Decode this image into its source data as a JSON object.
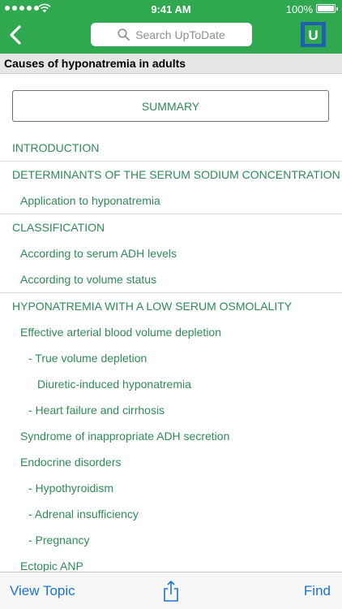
{
  "status_bar": {
    "time": "9:41 AM",
    "battery": "100%"
  },
  "nav": {
    "back_icon": "chevron-left-icon",
    "search_placeholder": "Search UpToDate",
    "logo_letter": "U"
  },
  "topic": {
    "title": "Causes of hyponatremia in adults"
  },
  "summary_button": "SUMMARY",
  "toc": [
    {
      "label": "INTRODUCTION",
      "level": 0
    },
    {
      "label": "DETERMINANTS OF THE SERUM SODIUM CONCENTRATION",
      "level": 0
    },
    {
      "label": "Application to hyponatremia",
      "level": 1
    },
    {
      "label": "CLASSIFICATION",
      "level": 0
    },
    {
      "label": "According to serum ADH levels",
      "level": 1
    },
    {
      "label": "According to volume status",
      "level": 1
    },
    {
      "label": "HYPONATREMIA WITH A LOW SERUM OSMOLALITY",
      "level": 0
    },
    {
      "label": "Effective arterial blood volume depletion",
      "level": 1
    },
    {
      "label": "- True volume depletion",
      "level": 2
    },
    {
      "label": "Diuretic-induced hyponatremia",
      "level": 3
    },
    {
      "label": "- Heart failure and cirrhosis",
      "level": 2
    },
    {
      "label": "Syndrome of inappropriate ADH secretion",
      "level": 1
    },
    {
      "label": "Endocrine disorders",
      "level": 1
    },
    {
      "label": "- Hypothyroidism",
      "level": 2
    },
    {
      "label": "- Adrenal insufficiency",
      "level": 2
    },
    {
      "label": "- Pregnancy",
      "level": 2
    },
    {
      "label": "Ectopic ANP",
      "level": 1
    }
  ],
  "bottom_bar": {
    "view_topic": "View Topic",
    "share_icon": "share-icon",
    "find": "Find"
  },
  "colors": {
    "header_green": "#2fa84f",
    "link_green": "#2e8b57",
    "toolbar_blue": "#1a73d9"
  }
}
